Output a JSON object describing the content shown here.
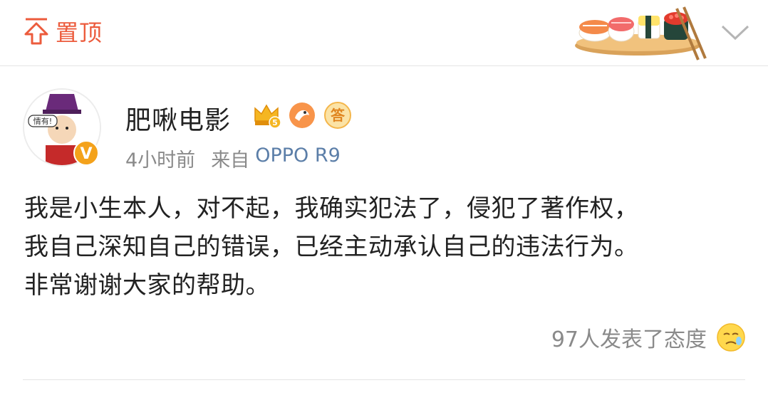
{
  "header": {
    "pin_label": "置顶",
    "banner_icon": "sushi-illustration",
    "expand_icon": "chevron-down-icon"
  },
  "post": {
    "author": {
      "name": "肥啾电影",
      "avatar_text": "情有!",
      "verified_badge": "V",
      "badges": [
        "crown-badge",
        "bird-badge",
        "answer-badge"
      ],
      "answer_badge_text": "答",
      "level_text": "5"
    },
    "time": "4小时前",
    "source_prefix": "来自",
    "device": "OPPO R9",
    "lines": [
      "我是小生本人，对不起，我确实犯法了，侵犯了著作权，",
      "我自己深知自己的错误，已经主动承认自己的违法行为。",
      "非常谢谢大家的帮助。"
    ],
    "reactions_text": "97人发表了态度",
    "reaction_icon": "emoji-face-icon"
  },
  "colors": {
    "accent": "#ec5b3c",
    "link": "#5b7ea8",
    "muted": "#8a8a8a",
    "text": "#222222"
  }
}
